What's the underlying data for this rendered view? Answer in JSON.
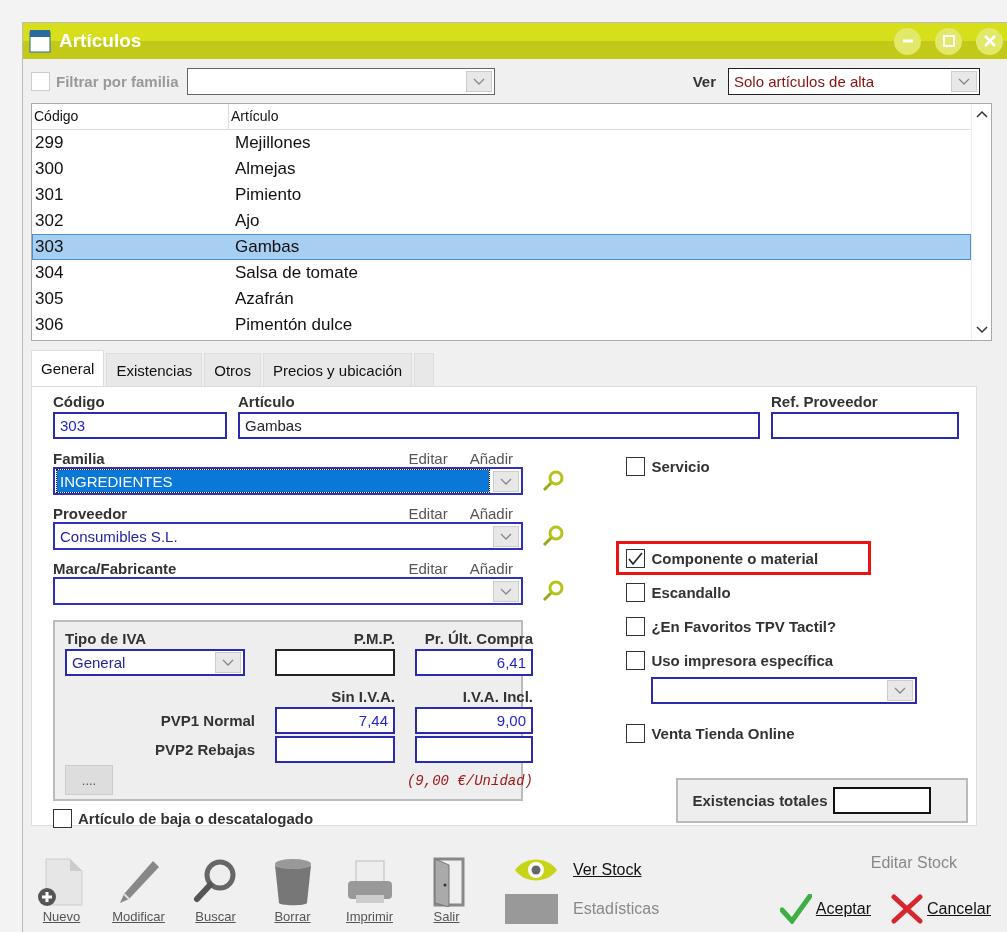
{
  "window": {
    "title": "Artículos"
  },
  "filter": {
    "label": "Filtrar por familia",
    "checked": false,
    "disabled": true
  },
  "view": {
    "label": "Ver",
    "value": "Solo artículos de alta"
  },
  "list": {
    "columns": [
      "Código",
      "Artículo"
    ],
    "rows": [
      {
        "code": "299",
        "name": "Mejillones",
        "selected": false
      },
      {
        "code": "300",
        "name": "Almejas",
        "selected": false
      },
      {
        "code": "301",
        "name": "Pimiento",
        "selected": false
      },
      {
        "code": "302",
        "name": "Ajo",
        "selected": false
      },
      {
        "code": "303",
        "name": "Gambas",
        "selected": true
      },
      {
        "code": "304",
        "name": "Salsa de tomate",
        "selected": false
      },
      {
        "code": "305",
        "name": "Azafrán",
        "selected": false
      },
      {
        "code": "306",
        "name": "Pimentón dulce",
        "selected": false
      }
    ]
  },
  "tabs": [
    {
      "label": "General",
      "selected": true
    },
    {
      "label": "Existencias",
      "selected": false
    },
    {
      "label": "Otros",
      "selected": false
    },
    {
      "label": "Precios y ubicación",
      "selected": false
    }
  ],
  "form": {
    "codigo": {
      "label": "Código",
      "value": "303"
    },
    "articulo": {
      "label": "Artículo",
      "value": "Gambas"
    },
    "ref_proveedor": {
      "label": "Ref. Proveedor"
    },
    "lookups": [
      {
        "label": "Familia",
        "edit": "Editar",
        "add": "Añadir",
        "value": "INGREDIENTES",
        "highlighted": true
      },
      {
        "label": "Proveedor",
        "edit": "Editar",
        "add": "Añadir",
        "value": "Consumibles S.L.",
        "highlighted": false
      },
      {
        "label": "Marca/Fabricante",
        "edit": "Editar",
        "add": "Añadir",
        "highlighted": false
      }
    ],
    "prices": {
      "iva_label": "Tipo de IVA",
      "iva_value": "General",
      "pmp_label": "P.M.P.",
      "last_label": "Pr. Últ. Compra",
      "last_value": "6,41",
      "net_label": "Sin I.V.A.",
      "gross_label": "I.V.A. Incl.",
      "rows": [
        {
          "label": "PVP1 Normal",
          "net": "7,44",
          "gross": "9,00"
        },
        {
          "label": "PVP2 Rebajas"
        }
      ],
      "more": "....",
      "unit_price": "(9,00 €/Unidad)"
    },
    "discontinued": {
      "label": "Artículo de baja o descatalogado",
      "checked": false
    },
    "options_top": [
      {
        "label": "Servicio",
        "checked": false,
        "highlighted": false
      }
    ],
    "options": [
      {
        "kind": "check",
        "label": "Componente o material",
        "checked": true,
        "highlighted": true
      },
      {
        "kind": "check",
        "label": "Escandallo",
        "checked": false,
        "highlighted": false
      },
      {
        "kind": "check",
        "label": "¿En Favoritos TPV Tactil?",
        "checked": false,
        "highlighted": false
      },
      {
        "kind": "check-select",
        "label": "Uso impresora específica",
        "checked": false,
        "highlighted": false
      },
      {
        "kind": "check",
        "label": "Venta Tienda Online",
        "checked": false,
        "highlighted": false
      }
    ],
    "stock": {
      "label": "Existencias totales"
    }
  },
  "toolbar": [
    {
      "kind": "new",
      "label": "Nuevo"
    },
    {
      "kind": "edit",
      "label": "Modificar"
    },
    {
      "kind": "search",
      "label": "Buscar"
    },
    {
      "kind": "delete",
      "label": "Borrar"
    },
    {
      "kind": "print",
      "label": "Imprimir"
    },
    {
      "kind": "exit",
      "label": "Salir"
    }
  ],
  "actions": {
    "view_stock": "Ver Stock",
    "stats": {
      "label": "Estadísticas",
      "disabled": true
    },
    "edit_stock": {
      "label": "Editar Stock",
      "disabled": true
    },
    "accept": "Aceptar",
    "cancel": "Cancelar"
  }
}
